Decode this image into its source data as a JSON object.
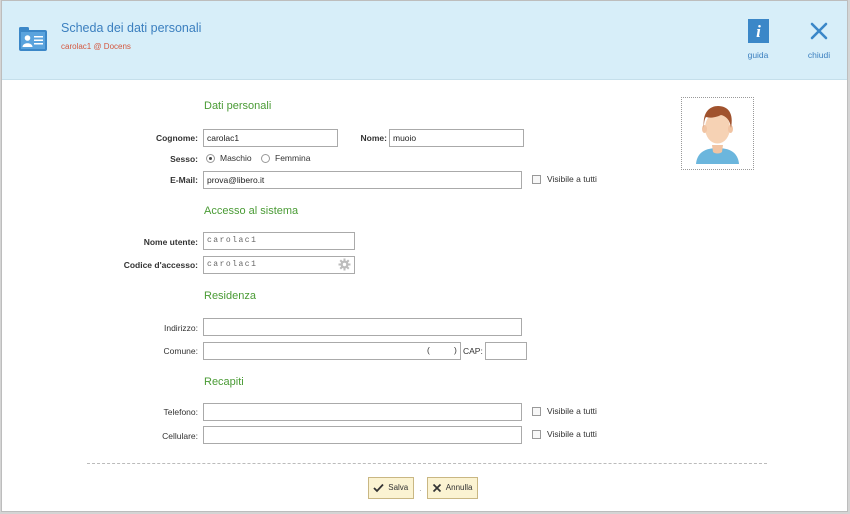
{
  "header": {
    "title": "Scheda dei dati personali",
    "subtitle": "carolac1 @ Docens",
    "guide_label": "guida",
    "close_label": "chiudi"
  },
  "sections": {
    "personal": "Dati personali",
    "access": "Accesso al sistema",
    "residence": "Residenza",
    "contacts": "Recapiti"
  },
  "personal": {
    "surname_label": "Cognome:",
    "surname_value": "carolac1",
    "name_label": "Nome:",
    "name_value": "muoio",
    "sex_label": "Sesso:",
    "sex_options": [
      "Maschio",
      "Femmina"
    ],
    "sex_selected": "Maschio",
    "email_label": "E-Mail:",
    "email_value": "prova@libero.it",
    "visible_label": "Visibile a tutti"
  },
  "access": {
    "username_label": "Nome utente:",
    "username_value": "carolac1",
    "code_label": "Codice d'accesso:",
    "code_value": "carolac1"
  },
  "residence": {
    "address_label": "Indirizzo:",
    "address_value": "",
    "town_label": "Comune:",
    "town_value": "",
    "province_open": "(",
    "province_close": ")",
    "cap_label": "CAP:",
    "cap_value": ""
  },
  "contacts": {
    "phone_label": "Telefono:",
    "phone_value": "",
    "mobile_label": "Cellulare:",
    "mobile_value": "",
    "visible_label": "Visibile a tutti"
  },
  "footer": {
    "save_label": "Salva",
    "separator": "·",
    "cancel_label": "Annulla"
  },
  "colors": {
    "header_bg": "#d7eef9",
    "accent_blue": "#3b7fbf",
    "section_green": "#4a9b35",
    "subtitle_red": "#d4573f",
    "button_bg": "#fbf3d2"
  },
  "icons": {
    "header": "contact-card-icon",
    "guide": "info-icon",
    "close": "close-icon",
    "code": "gear-icon",
    "save": "checkmark-icon",
    "cancel": "x-icon"
  }
}
